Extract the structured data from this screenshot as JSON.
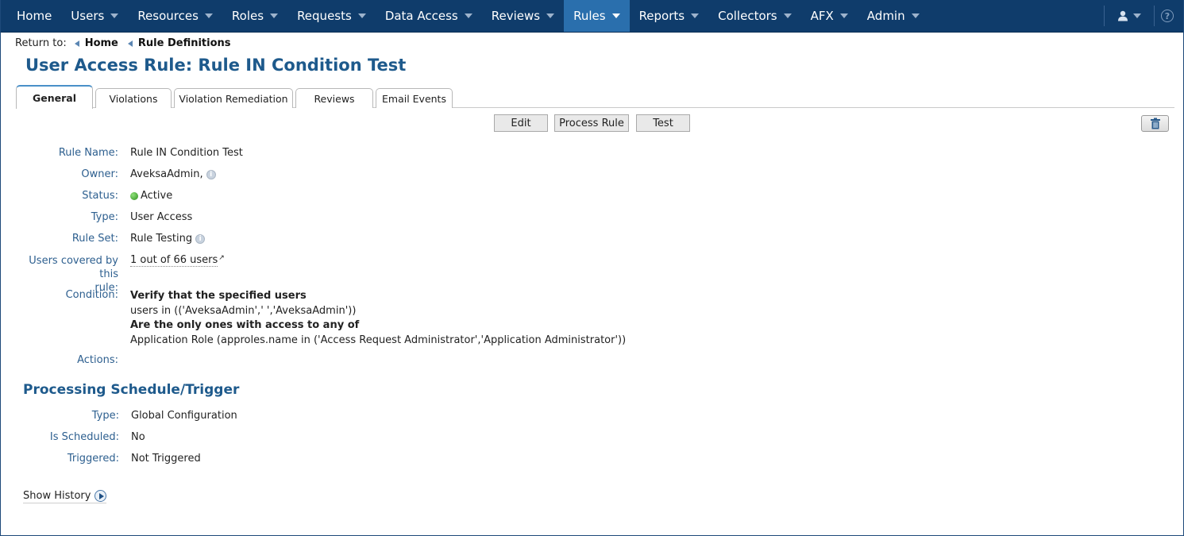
{
  "nav": {
    "items": [
      {
        "label": "Home",
        "has_caret": false
      },
      {
        "label": "Users",
        "has_caret": true
      },
      {
        "label": "Resources",
        "has_caret": true
      },
      {
        "label": "Roles",
        "has_caret": true
      },
      {
        "label": "Requests",
        "has_caret": true
      },
      {
        "label": "Data Access",
        "has_caret": true
      },
      {
        "label": "Reviews",
        "has_caret": true
      },
      {
        "label": "Rules",
        "has_caret": true,
        "active": true
      },
      {
        "label": "Reports",
        "has_caret": true
      },
      {
        "label": "Collectors",
        "has_caret": true
      },
      {
        "label": "AFX",
        "has_caret": true
      },
      {
        "label": "Admin",
        "has_caret": true
      }
    ],
    "user_icon": "user-icon",
    "help_icon": "help-icon",
    "help_glyph": "?"
  },
  "breadcrumb": {
    "label": "Return to:",
    "links": [
      "Home",
      "Rule Definitions"
    ]
  },
  "page": {
    "title": "User Access Rule: Rule IN Condition Test"
  },
  "tabs": [
    "General",
    "Violations",
    "Violation Remediation",
    "Reviews",
    "Email Events"
  ],
  "actions": {
    "edit": "Edit",
    "process": "Process Rule",
    "test": "Test",
    "delete_icon": "trash-icon"
  },
  "details": {
    "rule_name_label": "Rule Name:",
    "rule_name": "Rule IN Condition Test",
    "owner_label": "Owner:",
    "owner": "AveksaAdmin,",
    "status_label": "Status:",
    "status": "Active",
    "status_color": "#2e8f1e",
    "type_label": "Type:",
    "type": "User Access",
    "rule_set_label": "Rule Set:",
    "rule_set": "Rule Testing",
    "users_covered_label_1": "Users covered by this",
    "users_covered_label_2": "rule:",
    "users_covered": "1 out of 66 users",
    "condition_label": "Condition:",
    "condition_line1": "Verify that the specified users",
    "condition_line2": "users in (('AveksaAdmin',' ','AveksaAdmin'))",
    "condition_line3": "Are the only ones with access to any of",
    "condition_line4": "Application Role (approles.name in ('Access Request Administrator','Application Administrator'))",
    "actions_label": "Actions:"
  },
  "schedule": {
    "title": "Processing Schedule/Trigger",
    "type_label": "Type:",
    "type": "Global Configuration",
    "scheduled_label": "Is Scheduled:",
    "scheduled": "No",
    "triggered_label": "Triggered:",
    "triggered": "Not Triggered"
  },
  "history": {
    "label": "Show History"
  },
  "colors": {
    "nav_bg": "#0f3c6b",
    "nav_active": "#2a6fad",
    "title": "#1e5a8c",
    "label": "#2d5f8f"
  }
}
